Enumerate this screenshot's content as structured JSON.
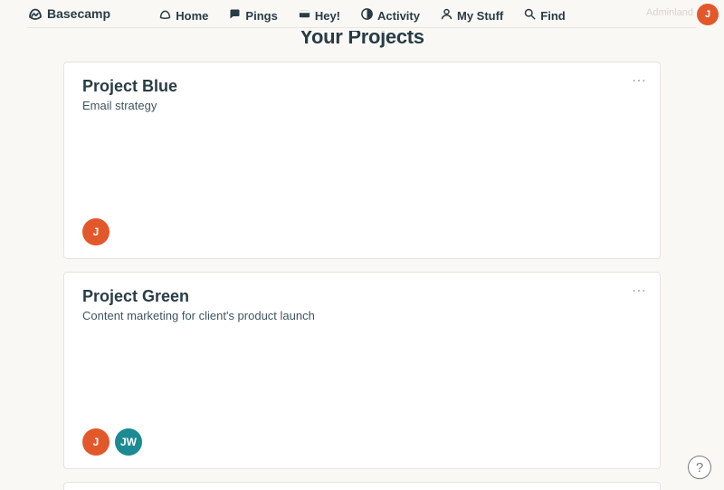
{
  "brand": {
    "name": "Basecamp"
  },
  "nav": {
    "home": {
      "label": "Home"
    },
    "pings": {
      "label": "Pings"
    },
    "hey": {
      "label": "Hey!"
    },
    "activity": {
      "label": "Activity"
    },
    "mystuff": {
      "label": "My Stuff"
    },
    "find": {
      "label": "Find"
    }
  },
  "header": {
    "admin_hint": "Adminland",
    "user_avatar_initial": "J"
  },
  "page": {
    "title": "Your Projects"
  },
  "projects": [
    {
      "title": "Project Blue",
      "description": "Email strategy",
      "avatars": [
        {
          "initials": "J",
          "class": "j"
        }
      ]
    },
    {
      "title": "Project Green",
      "description": "Content marketing for client's product launch",
      "avatars": [
        {
          "initials": "J",
          "class": "j"
        },
        {
          "initials": "JW",
          "class": "jw"
        }
      ]
    }
  ],
  "help": {
    "label": "?"
  },
  "more_glyph": "⋯"
}
